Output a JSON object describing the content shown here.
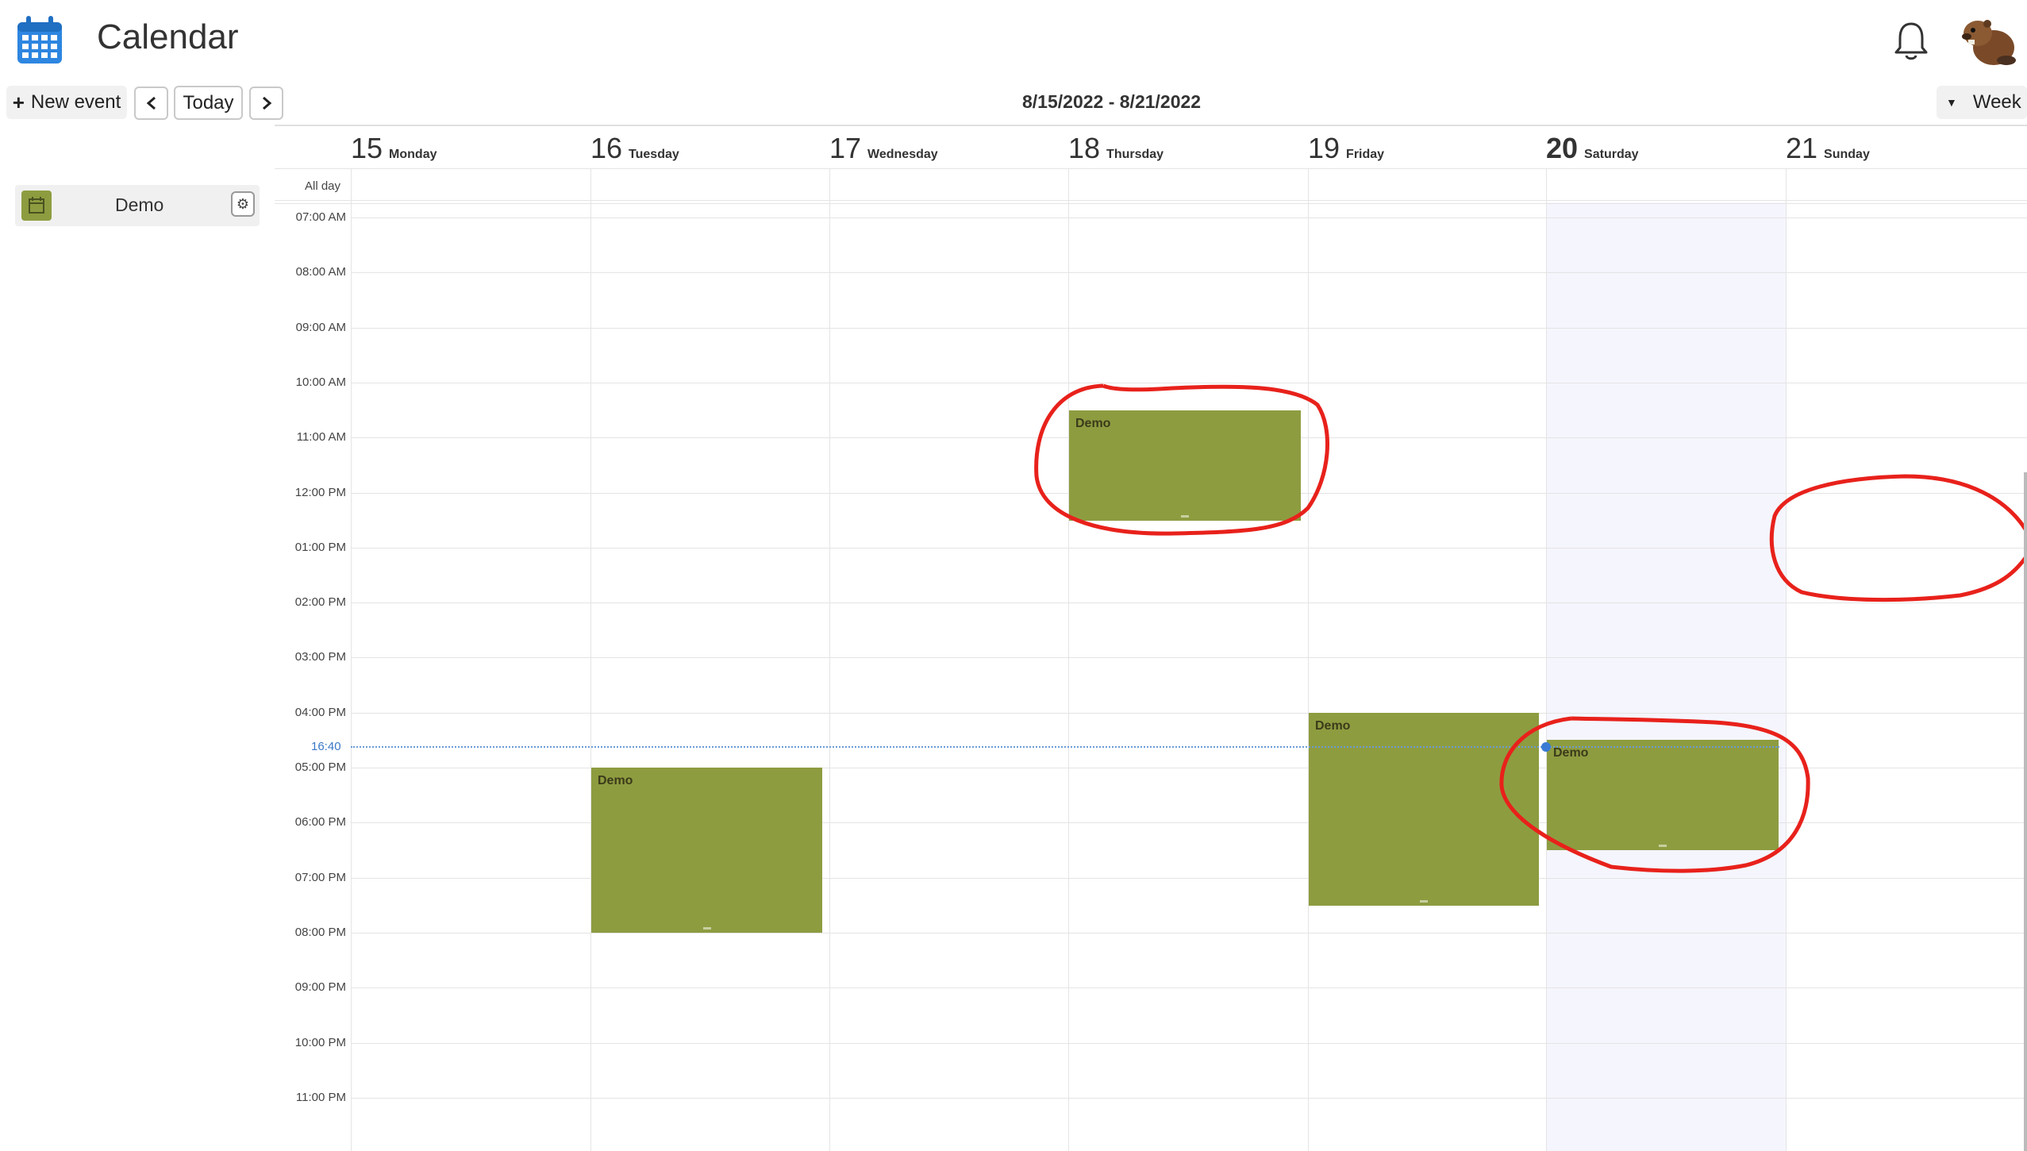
{
  "header": {
    "title": "Calendar",
    "app_icon": "calendar-icon",
    "bell_icon": "bell-icon",
    "avatar_icon": "beaver-avatar"
  },
  "toolbar": {
    "new_event_label": "New event",
    "today_label": "Today",
    "range_label": "8/15/2022 - 8/21/2022",
    "view_label": "Week"
  },
  "sidebar": {
    "calendars": [
      {
        "name": "Demo",
        "color": "#8e9c40"
      }
    ]
  },
  "week": {
    "all_day_label": "All day",
    "days": [
      {
        "num": "15",
        "name": "Monday"
      },
      {
        "num": "16",
        "name": "Tuesday"
      },
      {
        "num": "17",
        "name": "Wednesday"
      },
      {
        "num": "18",
        "name": "Thursday"
      },
      {
        "num": "19",
        "name": "Friday"
      },
      {
        "num": "20",
        "name": "Saturday",
        "today": true
      },
      {
        "num": "21",
        "name": "Sunday"
      }
    ],
    "times": [
      "07:00 AM",
      "08:00 AM",
      "09:00 AM",
      "10:00 AM",
      "11:00 AM",
      "12:00 PM",
      "01:00 PM",
      "02:00 PM",
      "03:00 PM",
      "04:00 PM",
      "05:00 PM",
      "06:00 PM",
      "07:00 PM",
      "08:00 PM",
      "09:00 PM",
      "10:00 PM",
      "11:00 PM"
    ],
    "now_label": "16:40"
  },
  "events": [
    {
      "title": "Demo",
      "day": "Thursday",
      "start": "10:30 AM",
      "end": "12:30 PM"
    },
    {
      "title": "Demo",
      "day": "Tuesday",
      "start": "05:00 PM",
      "end": "08:00 PM"
    },
    {
      "title": "Demo",
      "day": "Friday",
      "start": "04:00 PM",
      "end": "07:30 PM"
    },
    {
      "title": "Demo",
      "day": "Saturday",
      "start": "04:30 PM",
      "end": "06:30 PM"
    }
  ],
  "colors": {
    "event": "#8e9c40",
    "today_column": "#f5f5fe",
    "now_line": "#3a78c8",
    "annotation": "#e8211b"
  }
}
